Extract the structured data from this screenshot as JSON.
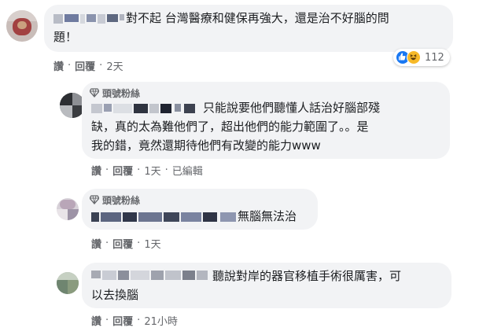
{
  "comments": [
    {
      "line1": "對不起 台灣醫療和健保再強大，還是治不好腦的問",
      "line2": "題！",
      "actions": {
        "like": "讚",
        "reply": "回覆",
        "time": "2天"
      },
      "reactions": {
        "icons": [
          "like-icon",
          "haha-icon"
        ],
        "count": "112",
        "colors": {
          "like": "#1877f2",
          "haha": "#f7b928"
        }
      }
    },
    {
      "badge": "頭號粉絲",
      "line1": "只能說要他們聽懂人話治好腦部殘",
      "line2": "缺，真的太為難他們了，超出他們的能力範圍了。。是",
      "line3": "我的錯，竟然還期待他們有改變的能力www",
      "actions": {
        "like": "讚",
        "reply": "回覆",
        "time": "1天",
        "edited": "已編輯"
      }
    },
    {
      "badge": "頭號粉絲",
      "line1": "無腦無法治",
      "actions": {
        "like": "讚",
        "reply": "回覆",
        "time": "1天"
      }
    },
    {
      "line1": "聽說對岸的器官移植手術很厲害，可",
      "line2": "以去換腦",
      "actions": {
        "like": "讚",
        "reply": "回覆",
        "time": "21小時"
      }
    }
  ],
  "colors": {
    "bubble": "#f2f3f5",
    "text": "#1c1e21",
    "muted": "#65676b"
  }
}
